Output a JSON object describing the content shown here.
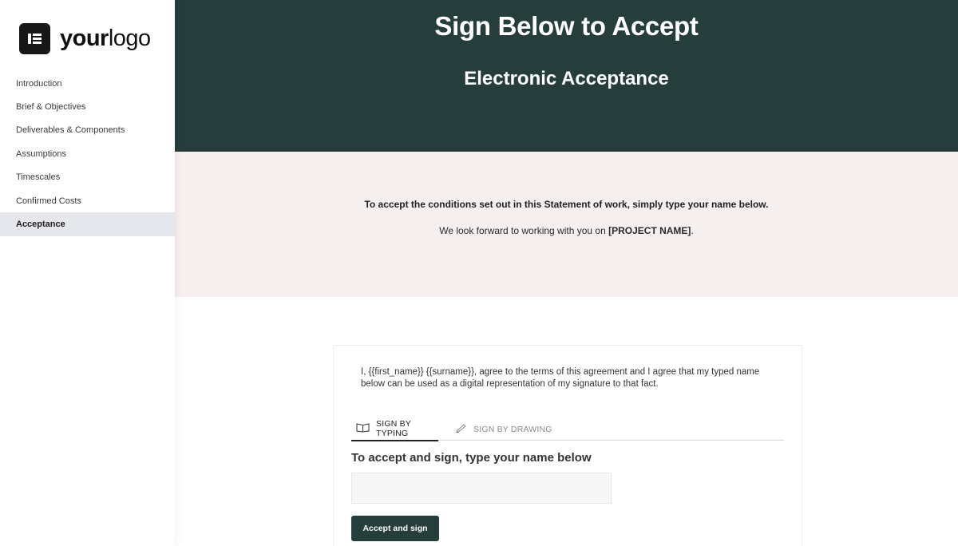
{
  "logo": {
    "bold": "your",
    "light": "logo"
  },
  "sidebar": {
    "items": [
      {
        "label": "Introduction"
      },
      {
        "label": "Brief & Objectives"
      },
      {
        "label": "Deliverables & Components"
      },
      {
        "label": "Assumptions"
      },
      {
        "label": "Timescales"
      },
      {
        "label": "Confirmed Costs"
      },
      {
        "label": "Acceptance",
        "active": true
      }
    ]
  },
  "hero": {
    "title": "Sign Below to Accept",
    "subtitle": "Electronic Acceptance"
  },
  "intro": {
    "line1": "To accept the conditions set out in this Statement of work, simply type your name below.",
    "line2_prefix": "We look forward to working with you on ",
    "line2_project": "[PROJECT NAME]",
    "line2_suffix": "."
  },
  "signature": {
    "agreement_text": "I, {{first_name}} {{surname}}, agree to the terms of this agreement and I agree that my typed name below can be used as a digital representation of my signature to that fact.",
    "tabs": [
      {
        "label": "SIGN BY TYPING",
        "icon": "keyboard-icon",
        "active": true
      },
      {
        "label": "SIGN BY DRAWING",
        "icon": "pen-icon",
        "active": false
      }
    ],
    "type_label": "To accept and sign, type your name below",
    "name_value": "",
    "name_placeholder": "",
    "accept_button": "Accept and sign"
  },
  "colors": {
    "dark_green": "#253d3b",
    "intro_bg": "#f6efef",
    "active_nav_bg": "#e5e7ec"
  }
}
